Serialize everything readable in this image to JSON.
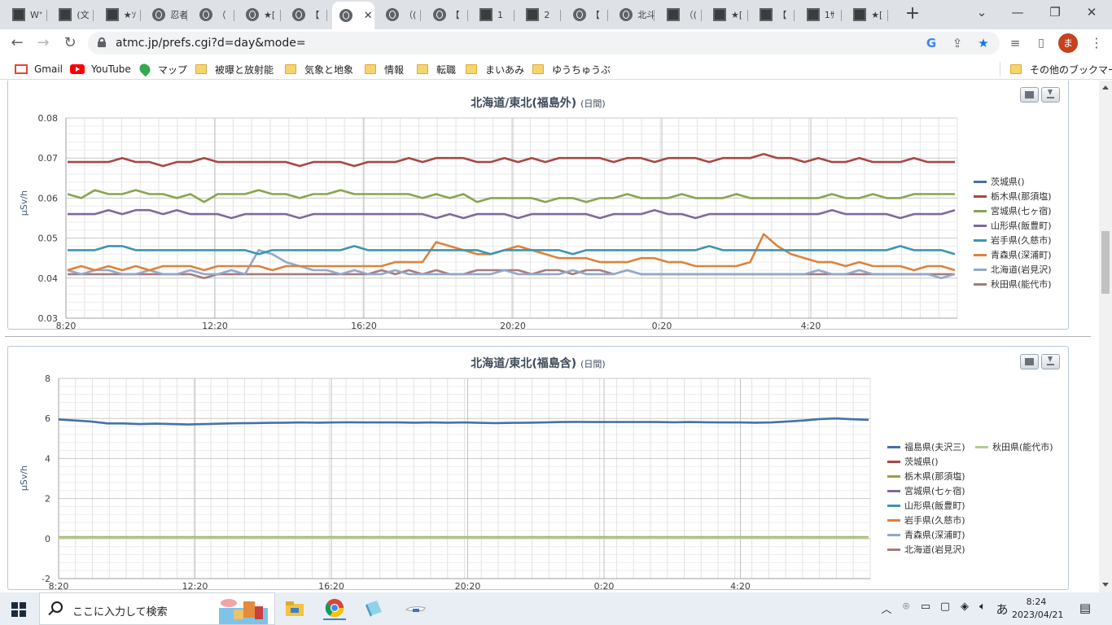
{
  "browser": {
    "tabs": [
      {
        "icon": "dark-site-icon",
        "title": "Wᐩ"
      },
      {
        "icon": "dark-site-icon",
        "title": "(文"
      },
      {
        "icon": "dark-site-icon",
        "title": "★ｿ"
      },
      {
        "icon": "globe-icon",
        "title": "忍者"
      },
      {
        "icon": "globe-icon",
        "title": "（"
      },
      {
        "icon": "globe-icon",
        "title": "★["
      },
      {
        "icon": "globe-icon",
        "title": "【"
      },
      {
        "icon": "globe-icon",
        "title": "",
        "active": true
      },
      {
        "icon": "globe-icon",
        "title": "（("
      },
      {
        "icon": "globe-icon",
        "title": "【"
      },
      {
        "icon": "dark-site-icon",
        "title": "1"
      },
      {
        "icon": "dark-site-icon",
        "title": "2"
      },
      {
        "icon": "globe-icon",
        "title": "【"
      },
      {
        "icon": "globe-icon",
        "title": "北斗"
      },
      {
        "icon": "dark-site-icon",
        "title": "（("
      },
      {
        "icon": "dark-site-icon",
        "title": "★["
      },
      {
        "icon": "dark-site-icon",
        "title": "【"
      },
      {
        "icon": "dark-site-icon",
        "title": "1ｻ"
      },
      {
        "icon": "dark-site-icon",
        "title": "★["
      }
    ],
    "new_tab_label": "+",
    "url": "atmc.jp/prefs.cgi?d=day&mode=",
    "avatar_initial": "ま",
    "bookmarks": [
      {
        "type": "gmail",
        "label": "Gmail"
      },
      {
        "type": "youtube",
        "label": "YouTube"
      },
      {
        "type": "maps",
        "label": "マップ"
      },
      {
        "type": "folder",
        "label": "被曝と放射能"
      },
      {
        "type": "folder",
        "label": "気象と地象"
      },
      {
        "type": "folder",
        "label": "情報"
      },
      {
        "type": "folder",
        "label": "転職"
      },
      {
        "type": "folder",
        "label": "まいあみ"
      },
      {
        "type": "folder",
        "label": "ゆうちゅうぶ"
      }
    ],
    "other_bookmarks": "その他のブックマーク"
  },
  "chart1": {
    "title": "北海道/東北(福島外)",
    "title_suffix": "(日間)",
    "ylabel": "μSv/h",
    "x_ticks": [
      "8:20",
      "12:20",
      "16:20",
      "20:20",
      "0:20",
      "4:20"
    ],
    "y_ticks": [
      "0.08",
      "0.07",
      "0.06",
      "0.05",
      "0.04",
      "0.03"
    ]
  },
  "chart2": {
    "title": "北海道/東北(福島含)",
    "title_suffix": "(日間)",
    "ylabel": "μSv/h",
    "x_ticks": [
      "8:20",
      "12:20",
      "16:20",
      "20:20",
      "0:20",
      "4:20"
    ],
    "y_ticks": [
      "8",
      "6",
      "4",
      "2",
      "0",
      "-2"
    ]
  },
  "chart_data": [
    {
      "type": "line",
      "title": "北海道/東北(福島外)",
      "ylabel": "μSv/h",
      "ylim": [
        0.03,
        0.08
      ],
      "x_ticks": [
        "8:20",
        "12:20",
        "16:20",
        "20:20",
        "0:20",
        "4:20"
      ],
      "grid": true,
      "legend": "right",
      "series": [
        {
          "name": "茨城県()",
          "color": "#4572a7",
          "values": []
        },
        {
          "name": "栃木県(那須塩)",
          "color": "#aa4643",
          "values": [
            0.069,
            0.069,
            0.069,
            0.069,
            0.07,
            0.069,
            0.069,
            0.068,
            0.069,
            0.069,
            0.07,
            0.069,
            0.069,
            0.069,
            0.069,
            0.069,
            0.069,
            0.068,
            0.069,
            0.069,
            0.069,
            0.068,
            0.069,
            0.069,
            0.069,
            0.07,
            0.069,
            0.07,
            0.07,
            0.07,
            0.069,
            0.069,
            0.07,
            0.069,
            0.07,
            0.069,
            0.07,
            0.07,
            0.07,
            0.07,
            0.069,
            0.07,
            0.07,
            0.069,
            0.07,
            0.07,
            0.07,
            0.069,
            0.07,
            0.07,
            0.07,
            0.071,
            0.07,
            0.07,
            0.069,
            0.07,
            0.069,
            0.069,
            0.07,
            0.069,
            0.069,
            0.069,
            0.07,
            0.069,
            0.069,
            0.069
          ]
        },
        {
          "name": "宮城県(七ヶ宿)",
          "color": "#89a54e",
          "values": [
            0.061,
            0.06,
            0.062,
            0.061,
            0.061,
            0.062,
            0.061,
            0.061,
            0.06,
            0.061,
            0.059,
            0.061,
            0.061,
            0.061,
            0.062,
            0.061,
            0.061,
            0.06,
            0.061,
            0.061,
            0.062,
            0.061,
            0.061,
            0.061,
            0.061,
            0.061,
            0.06,
            0.061,
            0.06,
            0.061,
            0.059,
            0.06,
            0.06,
            0.06,
            0.06,
            0.059,
            0.06,
            0.06,
            0.059,
            0.06,
            0.06,
            0.061,
            0.06,
            0.06,
            0.06,
            0.061,
            0.06,
            0.06,
            0.06,
            0.061,
            0.06,
            0.06,
            0.06,
            0.06,
            0.06,
            0.06,
            0.061,
            0.06,
            0.06,
            0.061,
            0.06,
            0.06,
            0.061,
            0.061,
            0.061,
            0.061
          ]
        },
        {
          "name": "山形県(飯豊町)",
          "color": "#80699b",
          "values": [
            0.056,
            0.056,
            0.056,
            0.057,
            0.056,
            0.057,
            0.057,
            0.056,
            0.057,
            0.056,
            0.056,
            0.056,
            0.055,
            0.056,
            0.056,
            0.056,
            0.056,
            0.055,
            0.056,
            0.056,
            0.056,
            0.056,
            0.056,
            0.056,
            0.056,
            0.056,
            0.056,
            0.055,
            0.056,
            0.055,
            0.056,
            0.056,
            0.056,
            0.055,
            0.056,
            0.056,
            0.056,
            0.056,
            0.056,
            0.055,
            0.056,
            0.056,
            0.056,
            0.057,
            0.056,
            0.056,
            0.055,
            0.056,
            0.056,
            0.056,
            0.056,
            0.056,
            0.056,
            0.056,
            0.056,
            0.056,
            0.057,
            0.056,
            0.056,
            0.056,
            0.056,
            0.055,
            0.056,
            0.056,
            0.056,
            0.057
          ]
        },
        {
          "name": "岩手県(久慈市)",
          "color": "#3d96ae",
          "values": [
            0.047,
            0.047,
            0.047,
            0.048,
            0.048,
            0.047,
            0.047,
            0.047,
            0.047,
            0.047,
            0.047,
            0.047,
            0.047,
            0.047,
            0.046,
            0.047,
            0.047,
            0.047,
            0.047,
            0.047,
            0.047,
            0.048,
            0.047,
            0.047,
            0.047,
            0.047,
            0.047,
            0.047,
            0.047,
            0.047,
            0.047,
            0.046,
            0.047,
            0.047,
            0.047,
            0.047,
            0.047,
            0.046,
            0.047,
            0.047,
            0.047,
            0.047,
            0.047,
            0.047,
            0.047,
            0.047,
            0.047,
            0.048,
            0.047,
            0.047,
            0.047,
            0.047,
            0.047,
            0.047,
            0.047,
            0.047,
            0.047,
            0.047,
            0.047,
            0.047,
            0.047,
            0.048,
            0.047,
            0.047,
            0.047,
            0.046
          ]
        },
        {
          "name": "青森県(深浦町)",
          "color": "#db843d",
          "values": [
            0.042,
            0.043,
            0.042,
            0.043,
            0.042,
            0.043,
            0.042,
            0.043,
            0.043,
            0.043,
            0.042,
            0.043,
            0.043,
            0.043,
            0.043,
            0.042,
            0.043,
            0.043,
            0.043,
            0.043,
            0.043,
            0.043,
            0.043,
            0.043,
            0.044,
            0.044,
            0.044,
            0.049,
            0.048,
            0.047,
            0.046,
            0.046,
            0.047,
            0.048,
            0.047,
            0.046,
            0.045,
            0.045,
            0.045,
            0.044,
            0.044,
            0.044,
            0.045,
            0.045,
            0.044,
            0.044,
            0.043,
            0.043,
            0.043,
            0.043,
            0.044,
            0.051,
            0.048,
            0.046,
            0.045,
            0.044,
            0.044,
            0.043,
            0.044,
            0.043,
            0.043,
            0.043,
            0.042,
            0.043,
            0.043,
            0.042
          ]
        },
        {
          "name": "北海道(岩見沢)",
          "color": "#92a8cd",
          "values": [
            0.042,
            0.041,
            0.042,
            0.042,
            0.041,
            0.041,
            0.042,
            0.041,
            0.041,
            0.042,
            0.041,
            0.041,
            0.042,
            0.041,
            0.047,
            0.046,
            0.044,
            0.043,
            0.042,
            0.042,
            0.041,
            0.042,
            0.041,
            0.041,
            0.042,
            0.041,
            0.041,
            0.041,
            0.041,
            0.041,
            0.041,
            0.041,
            0.042,
            0.041,
            0.041,
            0.041,
            0.041,
            0.042,
            0.041,
            0.041,
            0.041,
            0.042,
            0.041,
            0.041,
            0.041,
            0.041,
            0.041,
            0.041,
            0.041,
            0.041,
            0.041,
            0.041,
            0.041,
            0.041,
            0.041,
            0.042,
            0.041,
            0.041,
            0.042,
            0.041,
            0.041,
            0.041,
            0.041,
            0.041,
            0.04,
            0.041
          ]
        },
        {
          "name": "秋田県(能代市)",
          "color": "#a47d7c",
          "values": [
            0.041,
            0.041,
            0.041,
            0.041,
            0.041,
            0.041,
            0.041,
            0.041,
            0.041,
            0.041,
            0.04,
            0.041,
            0.041,
            0.041,
            0.041,
            0.041,
            0.041,
            0.041,
            0.041,
            0.041,
            0.041,
            0.041,
            0.041,
            0.042,
            0.041,
            0.042,
            0.041,
            0.042,
            0.041,
            0.041,
            0.042,
            0.042,
            0.042,
            0.042,
            0.041,
            0.042,
            0.042,
            0.041,
            0.042,
            0.042,
            0.041,
            0.042,
            0.041,
            0.041,
            0.041,
            0.041,
            0.041,
            0.041,
            0.041,
            0.041,
            0.041,
            0.041,
            0.041,
            0.041,
            0.041,
            0.041,
            0.041,
            0.041,
            0.041,
            0.041,
            0.041,
            0.041,
            0.041,
            0.041,
            0.041,
            0.041
          ]
        }
      ]
    },
    {
      "type": "line",
      "title": "北海道/東北(福島含)",
      "ylabel": "μSv/h",
      "ylim": [
        -2,
        8
      ],
      "x_ticks": [
        "8:20",
        "12:20",
        "16:20",
        "20:20",
        "0:20",
        "4:20"
      ],
      "grid": true,
      "legend": "right",
      "series": [
        {
          "name": "福島県(夫沢三)",
          "color": "#4572a7",
          "values": [
            5.95,
            5.9,
            5.85,
            5.75,
            5.75,
            5.72,
            5.74,
            5.72,
            5.7,
            5.72,
            5.74,
            5.76,
            5.77,
            5.78,
            5.79,
            5.8,
            5.79,
            5.8,
            5.81,
            5.8,
            5.8,
            5.8,
            5.79,
            5.8,
            5.79,
            5.8,
            5.78,
            5.77,
            5.78,
            5.79,
            5.8,
            5.82,
            5.83,
            5.82,
            5.82,
            5.82,
            5.82,
            5.82,
            5.81,
            5.82,
            5.81,
            5.8,
            5.8,
            5.79,
            5.8,
            5.85,
            5.9,
            5.97,
            6.0,
            5.96,
            5.93
          ]
        },
        {
          "name": "秋田県(能代市)",
          "color": "#b5ca92",
          "values": [
            0.04,
            0.04,
            0.04,
            0.04,
            0.04,
            0.04,
            0.04,
            0.04,
            0.04,
            0.04,
            0.04,
            0.04,
            0.04,
            0.04,
            0.04,
            0.04,
            0.04,
            0.04,
            0.04,
            0.04,
            0.04,
            0.04,
            0.04,
            0.04,
            0.04,
            0.04,
            0.04,
            0.04,
            0.04,
            0.04,
            0.04,
            0.04,
            0.04,
            0.04,
            0.04,
            0.04,
            0.04,
            0.04,
            0.04,
            0.04,
            0.04,
            0.04,
            0.04,
            0.04,
            0.04,
            0.04,
            0.04,
            0.04,
            0.04,
            0.04
          ]
        },
        {
          "name": "茨城県()",
          "color": "#aa4643",
          "values": []
        },
        {
          "name": "栃木県(那須塩)",
          "color": "#89a54e",
          "values": [
            0.07,
            0.07,
            0.07,
            0.07,
            0.07,
            0.07,
            0.07,
            0.07,
            0.07,
            0.07
          ]
        },
        {
          "name": "宮城県(七ヶ宿)",
          "color": "#80699b",
          "values": [
            0.06,
            0.06,
            0.06,
            0.06,
            0.06,
            0.06,
            0.06,
            0.06,
            0.06,
            0.06
          ]
        },
        {
          "name": "山形県(飯豊町)",
          "color": "#3d96ae",
          "values": [
            0.056,
            0.056,
            0.056,
            0.056,
            0.056,
            0.056,
            0.056,
            0.056,
            0.056,
            0.056
          ]
        },
        {
          "name": "岩手県(久慈市)",
          "color": "#db843d",
          "values": [
            0.047,
            0.047,
            0.047,
            0.047,
            0.047,
            0.047,
            0.047,
            0.047,
            0.047,
            0.047
          ]
        },
        {
          "name": "青森県(深浦町)",
          "color": "#92a8cd",
          "values": [
            0.044,
            0.044,
            0.044,
            0.044,
            0.044,
            0.044,
            0.044,
            0.044,
            0.044,
            0.044
          ]
        },
        {
          "name": "北海道(岩見沢)",
          "color": "#a47d7c",
          "values": [
            0.041,
            0.041,
            0.041,
            0.041,
            0.041,
            0.041,
            0.041,
            0.041,
            0.041,
            0.041
          ]
        }
      ]
    }
  ],
  "taskbar": {
    "search_placeholder": "ここに入力して検索",
    "time": "8:24",
    "date": "2023/04/21",
    "ime": "あ"
  }
}
